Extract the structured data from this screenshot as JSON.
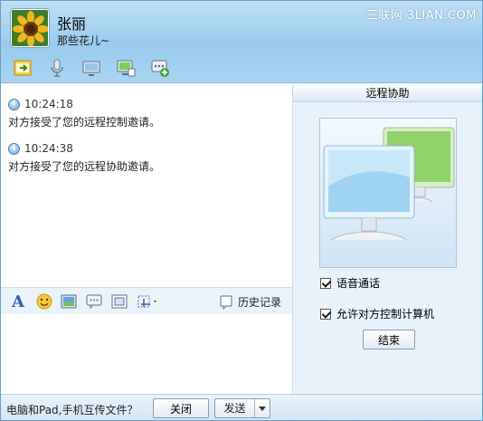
{
  "contact": {
    "name": "张丽",
    "signature": "那些花儿~"
  },
  "watermark": "三联网 3LIAN.COM",
  "toolbar": [
    {
      "name": "transfer-file-icon"
    },
    {
      "name": "voice-call-icon"
    },
    {
      "name": "video-call-icon"
    },
    {
      "name": "remote-desktop-icon"
    },
    {
      "name": "more-apps-icon"
    }
  ],
  "messages": [
    {
      "time": "10:24:18",
      "text": "对方接受了您的远程控制邀请。"
    },
    {
      "time": "10:24:38",
      "text": "对方接受了您的远程协助邀请。"
    }
  ],
  "format_bar": {
    "history_label": "历史记录"
  },
  "side_panel": {
    "title": "远程协助",
    "voice_label": "语音通话",
    "voice_checked": true,
    "allow_control_label": "允许对方控制计算机",
    "allow_control_checked": true,
    "end_label": "结束"
  },
  "bottom_bar": {
    "tip": "电脑和Pad,手机互传文件？",
    "close_label": "关闭",
    "send_label": "发送"
  },
  "colors": {
    "header": "#a9d5f2",
    "side_panel": "#e8f2fa",
    "border": "#6a9fc9"
  }
}
